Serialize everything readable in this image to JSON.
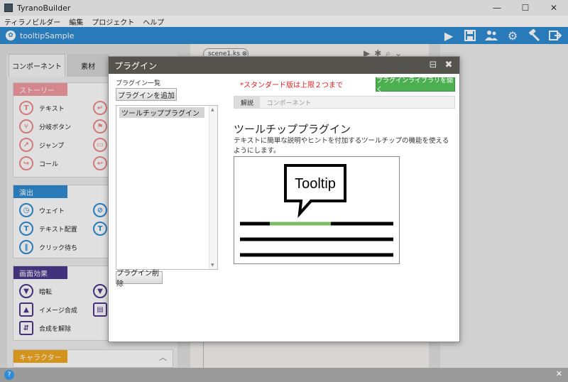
{
  "window": {
    "app_title": "TyranoBuilder",
    "controls": [
      "—",
      "☐",
      "✕"
    ]
  },
  "menu": [
    "ティラノビルダー",
    "編集",
    "プロジェクト",
    "ヘルプ"
  ],
  "appbar": {
    "project_name": "tooltipSample",
    "tool_icons": [
      "play-icon",
      "save-icon",
      "users-icon",
      "gear-icon",
      "hammer-icon",
      "export-icon"
    ]
  },
  "left_panel": {
    "tabs": [
      "コンポーネント",
      "素材"
    ],
    "sections": [
      {
        "label": "ストーリー",
        "color": "#f29aa0",
        "items": [
          "テキスト",
          "分岐ボタン",
          "ジャンプ",
          "コール"
        ]
      },
      {
        "label": "演出",
        "color": "#2f8bd3",
        "items": [
          "ウェイト",
          "テキスト配置",
          "クリック待ち"
        ]
      },
      {
        "label": "画面効果",
        "color": "#4a3a8c",
        "items": [
          "暗転",
          "イメージ合成",
          "合成を解除"
        ]
      },
      {
        "label": "キャラクター",
        "color": "#f2a81e",
        "items": []
      }
    ]
  },
  "scene": {
    "tab_label": "scene1.ks ⊗"
  },
  "dialog": {
    "title": "プラグイン",
    "list_caption": "プラグイン一覧",
    "add_button": "プラグインを追加",
    "plugins": [
      "ツールチッププラグイン"
    ],
    "delete_button": "プラグイン削除",
    "notice": "*スタンダード版は上限２つまで",
    "library_button": "プラグインライブラリを開く",
    "detail_tabs": [
      "解説",
      "コンポーネント"
    ],
    "plugin_name": "ツールチッププラグイン",
    "plugin_description": "テキストに簡単な説明やヒントを付加するツールチップの機能を使えるようにします。",
    "preview_tooltip_text": "Tooltip",
    "accent_green": "#4caf50",
    "notice_color": "#e02020"
  },
  "bottom": {
    "help_icon": "?",
    "close_icon": "✕"
  }
}
